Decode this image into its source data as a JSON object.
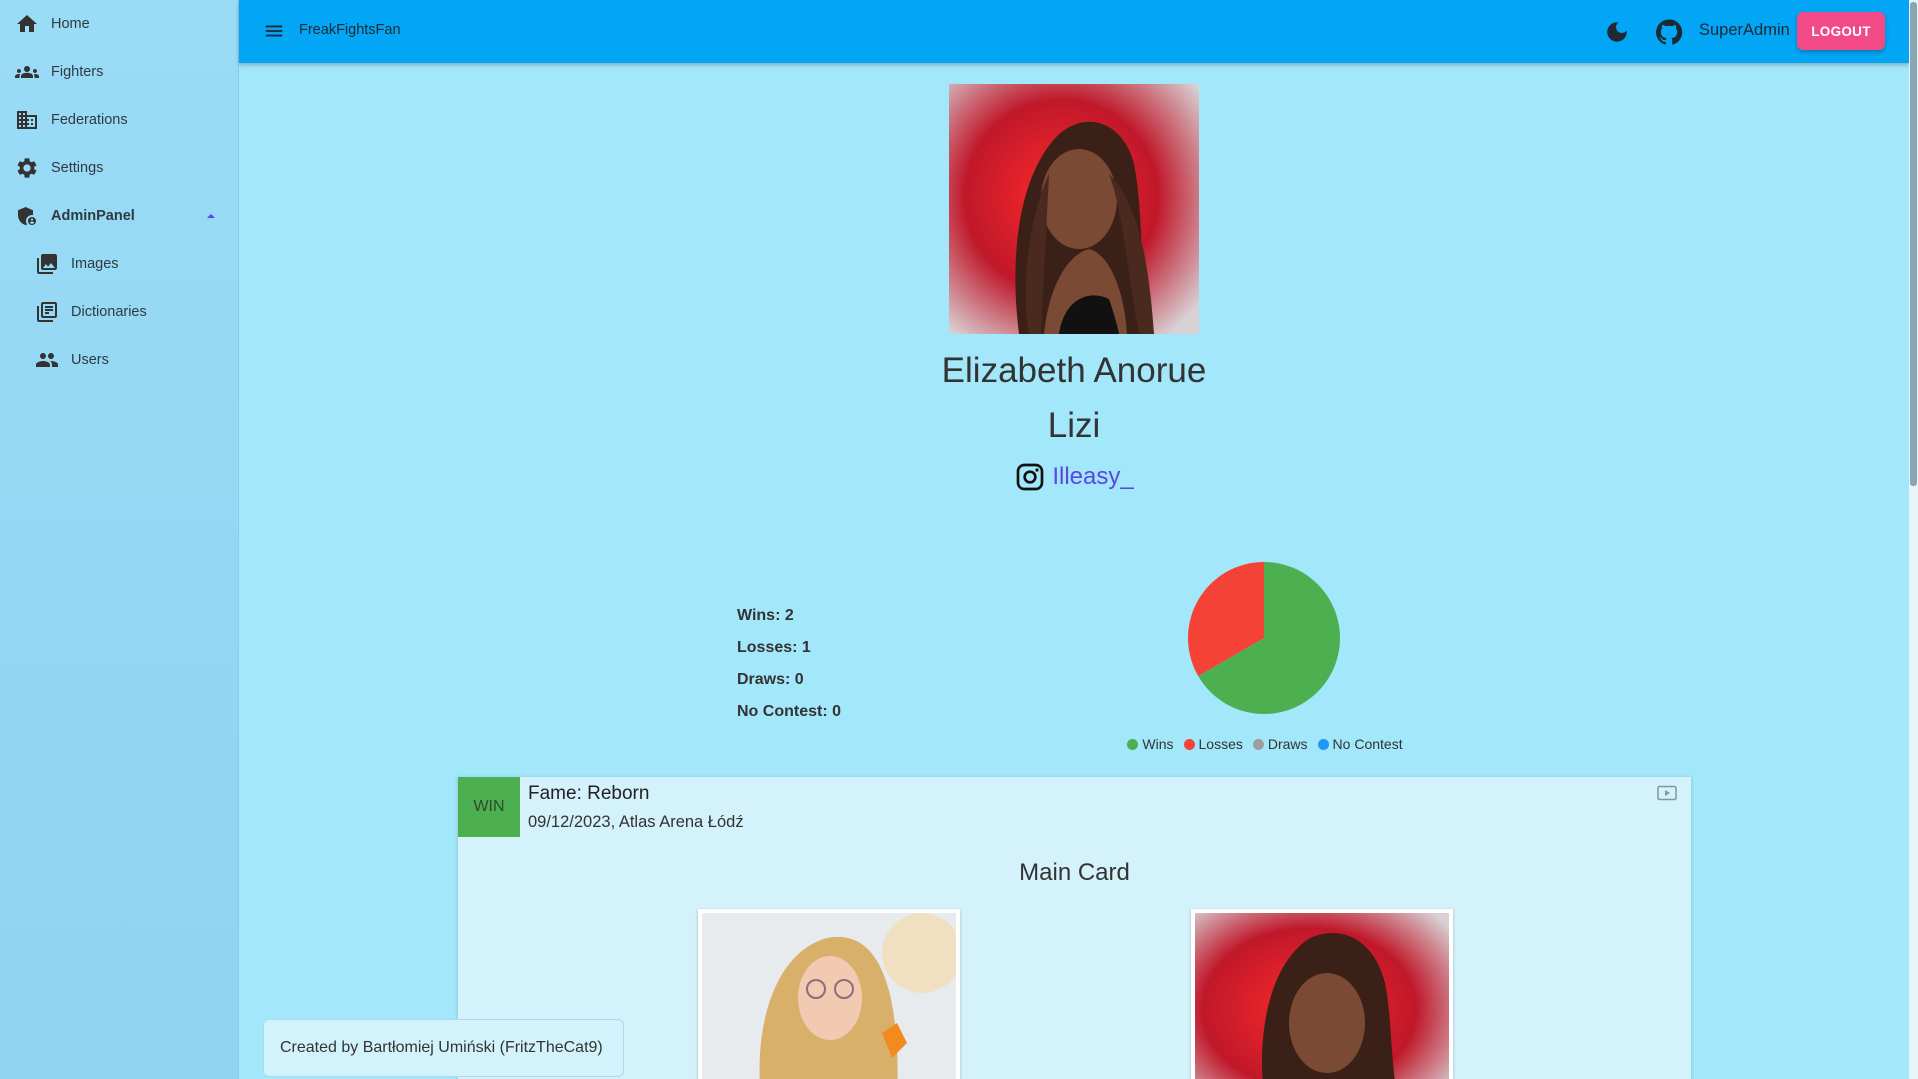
{
  "app": {
    "title": "FreakFightsFan",
    "username": "SuperAdmin",
    "logout_label": "LOGOUT"
  },
  "sidebar": {
    "items": [
      {
        "label": "Home",
        "icon": "home-icon"
      },
      {
        "label": "Fighters",
        "icon": "groups-icon"
      },
      {
        "label": "Federations",
        "icon": "domain-icon"
      },
      {
        "label": "Settings",
        "icon": "gear-icon"
      },
      {
        "label": "AdminPanel",
        "icon": "admin-shield-icon",
        "expanded": true
      },
      {
        "label": "Images",
        "icon": "photo-library-icon"
      },
      {
        "label": "Dictionaries",
        "icon": "library-books-icon"
      },
      {
        "label": "Users",
        "icon": "people-icon"
      }
    ]
  },
  "fighter": {
    "name": "Elizabeth Anorue",
    "nickname": "Lizi",
    "instagram": "Illeasy_"
  },
  "stats": {
    "wins": "Wins: 2",
    "losses": "Losses: 1",
    "draws": "Draws: 0",
    "no_contest": "No Contest: 0"
  },
  "chart_data": {
    "type": "pie",
    "categories": [
      "Wins",
      "Losses",
      "Draws",
      "No Contest"
    ],
    "values": [
      2,
      1,
      0,
      0
    ],
    "colors": [
      "#4caf50",
      "#f44336",
      "#9e9e9e",
      "#2196f3"
    ],
    "legend": "bottom"
  },
  "fight": {
    "result": "WIN",
    "event": "Fame: Reborn",
    "meta": "09/12/2023, Atlas Arena Łódź",
    "section": "Main Card"
  },
  "footer": {
    "credits": "Created by Bartłomiej Umiński (FritzTheCat9)"
  },
  "colors": {
    "appbar": "#03a5f5",
    "background": "#a3e7fb",
    "logout": "#f24a87",
    "link": "#5b44e8"
  }
}
